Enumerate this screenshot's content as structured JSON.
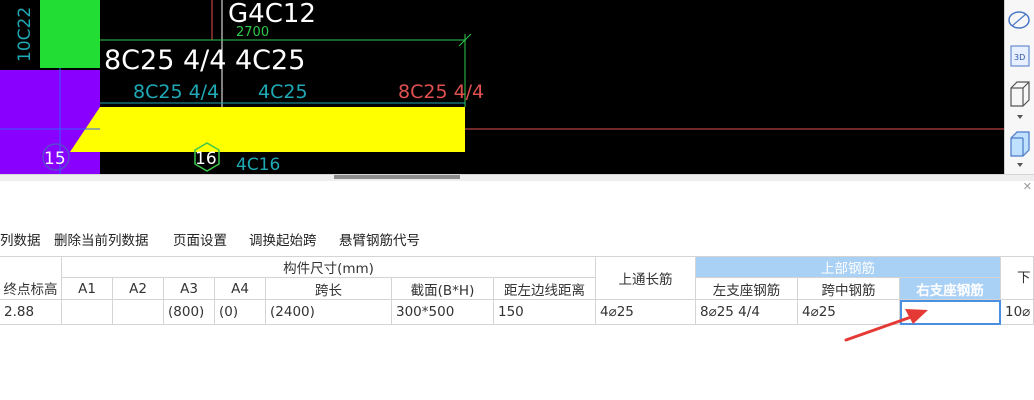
{
  "canvas": {
    "labels": {
      "g4c12": "G4C12",
      "dim_2700": "2700",
      "top_rebar": "8C25 4/4 4C25",
      "cyan_left": "8C25 4/4",
      "cyan_mid": "4C25",
      "red_right": "8C25 4/4",
      "bottom_rebar": "4C16",
      "left_vertical": "10C22",
      "node_15": "15",
      "node_16": "16"
    },
    "colors": {
      "background": "#000000",
      "beam": "#ffff00",
      "column_green": "#22dd33",
      "column_purple": "#8a00ff",
      "cyan": "#1fa9b5",
      "red": "#e05050",
      "white": "#ffffff",
      "dim_green": "#2ec84a"
    }
  },
  "side_toolbar": {
    "icons": [
      "ellipse-icon",
      "3d-view-icon",
      "cube-wire-icon",
      "cube-solid-icon"
    ],
    "badge_3d": "3D"
  },
  "toolbar": {
    "items": [
      "列数据",
      "删除当前列数据",
      "页面设置",
      "调换起始跨",
      "悬臂钢筋代号"
    ]
  },
  "table": {
    "headers": {
      "end_elevation": "终点标高",
      "dimensions": "构件尺寸(mm)",
      "a1": "A1",
      "a2": "A2",
      "a3": "A3",
      "a4": "A4",
      "span": "跨长",
      "section": "截面(B*H)",
      "left_dist": "距左边线距离",
      "top_through": "上通长筋",
      "top_rebar": "上部钢筋",
      "left_support": "左支座钢筋",
      "mid_span": "跨中钢筋",
      "right_support": "右支座钢筋",
      "lower": "下"
    },
    "row": {
      "end_elevation": "2.88",
      "a1": "",
      "a2": "",
      "a3": "(800)",
      "a4": "(0)",
      "span": "(2400)",
      "section": "300*500",
      "left_dist": "150",
      "top_through": "4⌀25",
      "left_support": "8⌀25 4/4",
      "mid_span": "4⌀25",
      "right_support": "",
      "lower": "10⌀"
    }
  }
}
